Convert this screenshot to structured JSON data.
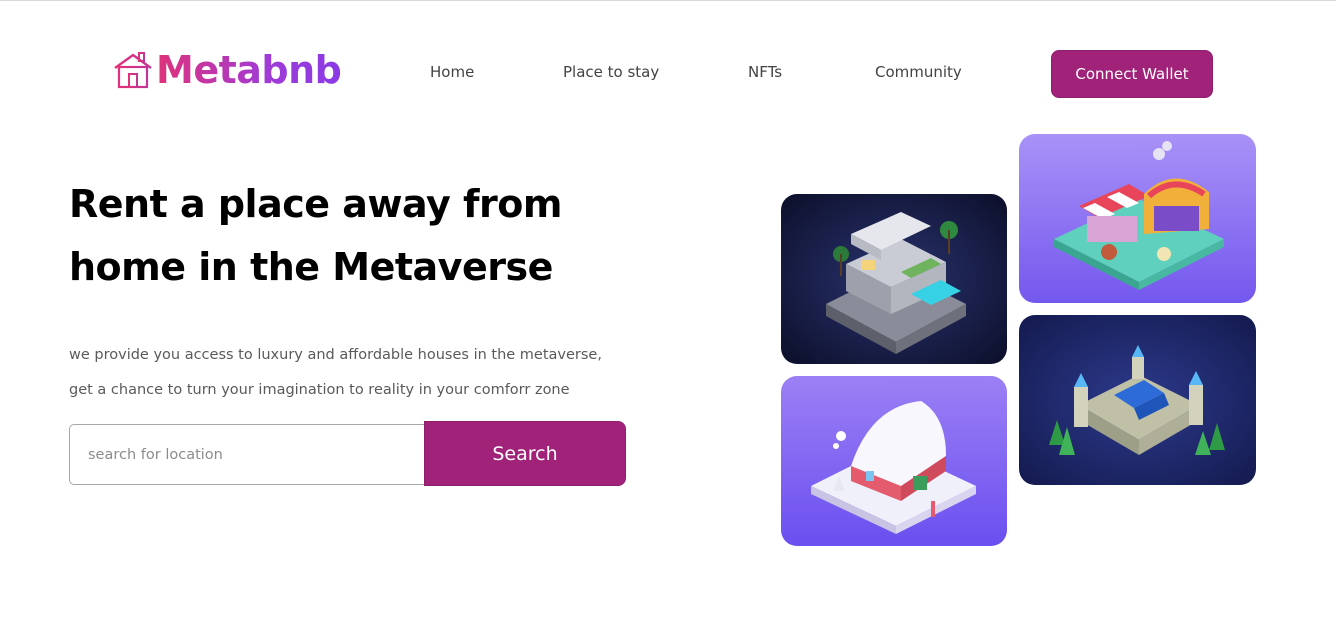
{
  "brand": {
    "name": "Metabnb",
    "logo_icon": "house-icon",
    "gradient": [
      "#e0317a",
      "#8a3be6"
    ]
  },
  "nav": {
    "items": [
      {
        "label": "Home"
      },
      {
        "label": "Place to stay"
      },
      {
        "label": "NFTs"
      },
      {
        "label": "Community"
      }
    ],
    "connect_label": "Connect Wallet"
  },
  "hero": {
    "title_line1": "Rent a place away from",
    "title_line2": "home in the Metaverse",
    "subtitle_line1": "we provide you access to luxury and affordable houses in the metaverse,",
    "subtitle_line2": "get a chance to turn your imagination to reality in your comforr zone"
  },
  "search": {
    "placeholder": "search for location",
    "button_label": "Search"
  },
  "gallery": [
    {
      "name": "modern-villa-image",
      "bg": "#1b1f4a"
    },
    {
      "name": "market-stall-image",
      "bg": "#8c6cf2"
    },
    {
      "name": "snow-cottage-image",
      "bg": "#7b5ef0"
    },
    {
      "name": "castle-image",
      "bg": "#1f2566"
    }
  ],
  "colors": {
    "accent": "#a02279",
    "text": "#000000",
    "muted": "#5a5a5a"
  }
}
